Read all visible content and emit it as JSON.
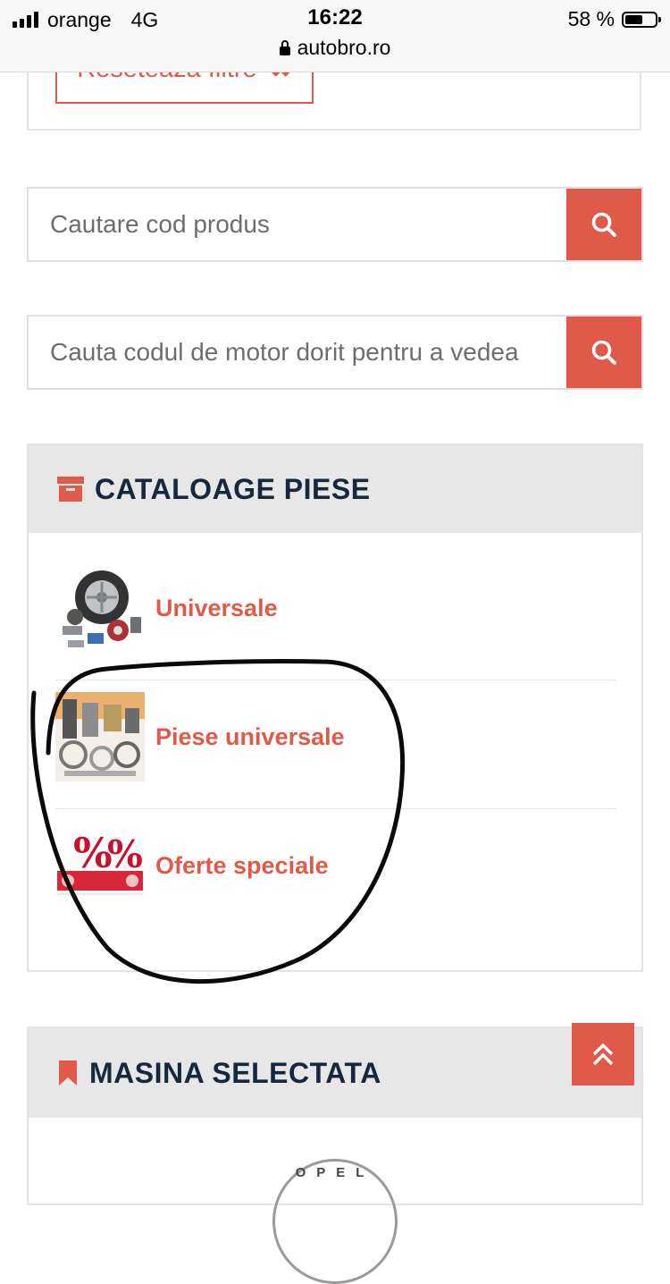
{
  "status_bar": {
    "carrier": "orange",
    "network": "4G",
    "time": "16:22",
    "url": "autobro.ro",
    "battery": "58 %",
    "battery_level": 0.58
  },
  "filters": {
    "reset_label": "Reseteaza filtre",
    "reset_icon": "close-icon"
  },
  "search_code": {
    "placeholder": "Cautare cod produs",
    "icon": "search-icon"
  },
  "search_engine": {
    "placeholder": "Cauta codul de motor dorit pentru a vedea",
    "icon": "search-icon"
  },
  "catalogs": {
    "title": "CATALOAGE PIESE",
    "icon": "archive-box-icon",
    "items": [
      {
        "label": "Universale",
        "thumb": "tires-parts-image"
      },
      {
        "label": "Piese universale",
        "thumb": "engine-parts-image"
      },
      {
        "label": "Oferte speciale",
        "thumb": "discount-percent-image"
      }
    ]
  },
  "selected_car": {
    "title": "MASINA SELECTATA",
    "icon": "bookmark-icon",
    "logo_text": "OPEL"
  },
  "colors": {
    "accent": "#e05a4a",
    "heading": "#17283d",
    "panel_header": "#e7e7e7"
  }
}
